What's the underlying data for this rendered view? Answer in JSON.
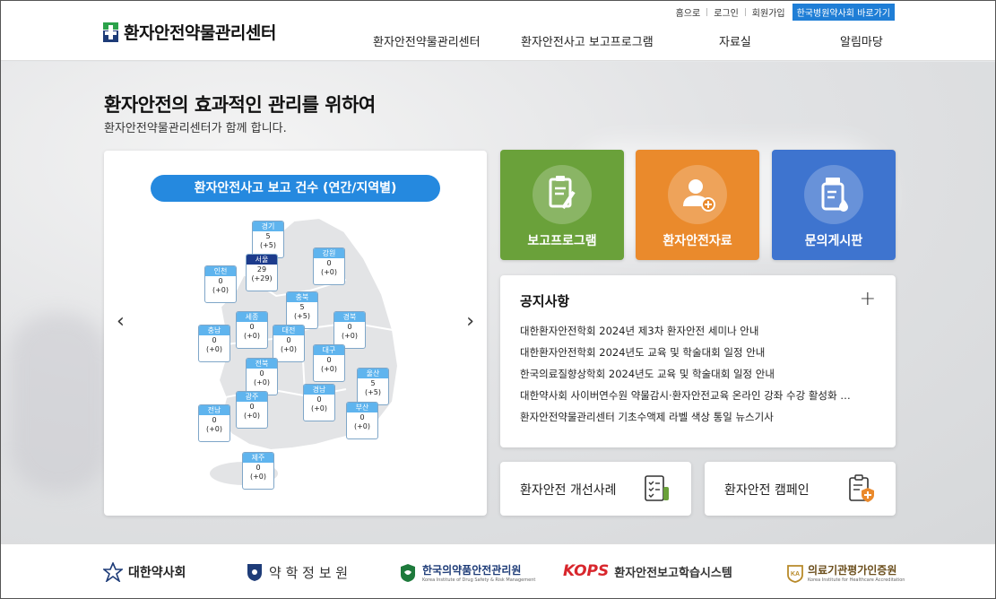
{
  "header": {
    "logo_text": "환자안전약물관리센터",
    "util_links": [
      "홈으로",
      "로그인",
      "회원가입"
    ],
    "hospital_button": "한국병원약사회 바로가기",
    "nav": [
      "환자안전약물관리센터",
      "환자안전사고 보고프로그램",
      "자료실",
      "알림마당"
    ]
  },
  "hero": {
    "title": "환자안전의 효과적인 관리를 위하여",
    "subtitle": "환자안전약물관리센터가 함께 합니다."
  },
  "map_card": {
    "pill": "환자안전사고 보고 건수 (연간/지역별)",
    "prev": "‹",
    "next": "›",
    "regions": [
      {
        "name": "경기",
        "count": "5",
        "delta": "(+5)"
      },
      {
        "name": "서울",
        "count": "29",
        "delta": "(+29)"
      },
      {
        "name": "강원",
        "count": "0",
        "delta": "(+0)"
      },
      {
        "name": "인천",
        "count": "0",
        "delta": "(+0)"
      },
      {
        "name": "충북",
        "count": "5",
        "delta": "(+5)"
      },
      {
        "name": "세종",
        "count": "0",
        "delta": "(+0)"
      },
      {
        "name": "경북",
        "count": "0",
        "delta": "(+0)"
      },
      {
        "name": "충남",
        "count": "0",
        "delta": "(+0)"
      },
      {
        "name": "대전",
        "count": "0",
        "delta": "(+0)"
      },
      {
        "name": "대구",
        "count": "0",
        "delta": "(+0)"
      },
      {
        "name": "전북",
        "count": "0",
        "delta": "(+0)"
      },
      {
        "name": "울산",
        "count": "5",
        "delta": "(+5)"
      },
      {
        "name": "경남",
        "count": "0",
        "delta": "(+0)"
      },
      {
        "name": "광주",
        "count": "0",
        "delta": "(+0)"
      },
      {
        "name": "전남",
        "count": "0",
        "delta": "(+0)"
      },
      {
        "name": "부산",
        "count": "0",
        "delta": "(+0)"
      },
      {
        "name": "제주",
        "count": "0",
        "delta": "(+0)"
      }
    ]
  },
  "tiles": [
    {
      "label": "보고프로그램",
      "icon": "clipboard-pen-icon",
      "color": "#6aa13a"
    },
    {
      "label": "환자안전자료",
      "icon": "user-plus-icon",
      "color": "#ea8a2c"
    },
    {
      "label": "문의게시판",
      "icon": "medicine-bottle-icon",
      "color": "#3e74cf"
    }
  ],
  "notice": {
    "title": "공지사항",
    "more": "+",
    "items": [
      "대한환자안전학회 2024년 제3차 환자안전 세미나 안내",
      "대한환자안전학회 2024년도 교육 및 학술대회 일정 안내",
      "한국의료질향상학회 2024년도 교육 및 학술대회 일정 안내",
      "대한약사회 사이버연수원 약물감시·환자안전교육 온라인 강좌 수강 활성화 …",
      "환자안전약물관리센터 기초수액제 라벨 색상 통일 뉴스기사"
    ]
  },
  "quick": [
    {
      "label": "환자안전 개선사례",
      "icon": "checklist-icon"
    },
    {
      "label": "환자안전 캠페인",
      "icon": "clipboard-shield-icon"
    }
  ],
  "footer": {
    "partners": [
      "대한약사회",
      "약 학 정 보 원",
      "한국의약품안전관리원",
      "환자안전보고학습시스템",
      "의료기관평가인증원"
    ],
    "kops": "KOPS",
    "sublines": [
      "Korea Institute of Drug Safety & Risk Management",
      "Korea Institute for Healthcare Accreditation"
    ]
  }
}
